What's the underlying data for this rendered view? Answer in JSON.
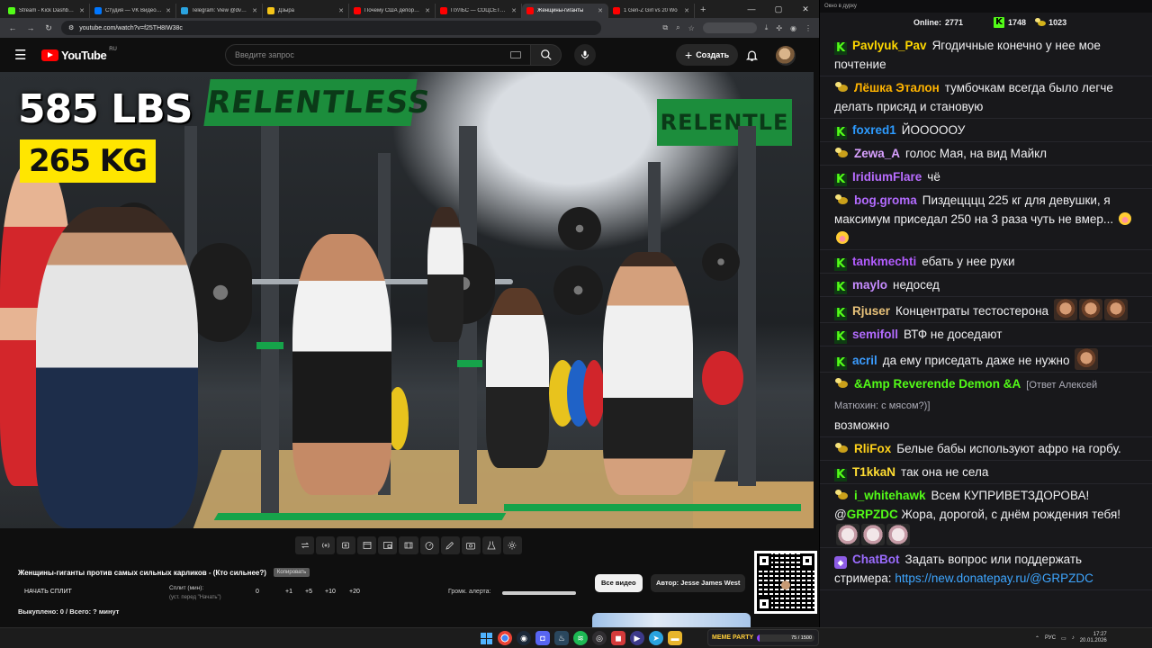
{
  "browser": {
    "tabs": [
      {
        "title": "Stream - Kick Dashboard",
        "color": "#53fc18",
        "active": false
      },
      {
        "title": "Студия — VK Видео Live",
        "color": "#0077ff",
        "active": false
      },
      {
        "title": "Telegram: View @dvach",
        "color": "#2aa3df",
        "active": false
      },
      {
        "title": "Дзыра",
        "color": "#f5c518",
        "active": false
      },
      {
        "title": "Почему США депортир",
        "color": "#ff0000",
        "active": false
      },
      {
        "title": "ПУЛЬС — СОЦСЕТЬ Д",
        "color": "#ff0000",
        "active": false
      },
      {
        "title": "Женщины-гиганты",
        "color": "#ff0000",
        "active": true
      },
      {
        "title": "1 Gen-Z Girl vs 20 Wo",
        "color": "#ff0000",
        "active": false
      }
    ],
    "new_tab": "+",
    "url": "youtube.com/watch?v=f25TH8IW38c"
  },
  "youtube": {
    "logo_text": "YouTube",
    "region": "RU",
    "search_placeholder": "Введите запрос",
    "create_label": "Создать",
    "video": {
      "overlay_weight_lbs": "585 LBS",
      "overlay_weight_kg": "265 KG",
      "banner_text": "RELENTLESS"
    },
    "title": "Женщины-гиганты против самых сильных карликов - (Кто сильнее?)",
    "copy_label": "Копировать",
    "split_button": "НАЧАТЬ СПЛИТ",
    "split_label": "Сплит (мин):",
    "split_sub": "(уст. перед \"Начать\")",
    "split_values": [
      "0",
      "+1",
      "+5",
      "+10",
      "+20"
    ],
    "alert_label": "Громк. алерта:",
    "bought_text": "Выкуплено: 0 / Всего: ? минут",
    "chip_all": "Все видео",
    "chip_author": "Автор: Jesse James West"
  },
  "chat": {
    "window_title": "Окно в дурку",
    "online_label": "Online:",
    "online_count": "2771",
    "kick_count": "1748",
    "coin_count": "1023",
    "messages": [
      {
        "badge": "kick",
        "user": "Pavlyuk_Pav",
        "color": "#ffd800",
        "text": "Ягодичные конечно у нее мое почтение"
      },
      {
        "badge": "coin",
        "user": "Лёшка Эталон",
        "color": "#ffb400",
        "text": "тумбочкам всегда было легче делать присяд и становую"
      },
      {
        "badge": "kick",
        "user": "foxred1",
        "color": "#2d9bff",
        "text": "ЙОООООУ"
      },
      {
        "badge": "coin",
        "user": "Zewa_A",
        "color": "#d8a0ff",
        "text": "голос Мая, на вид Майкл"
      },
      {
        "badge": "kick",
        "user": "IridiumFlare",
        "color": "#b86cff",
        "text": "чё"
      },
      {
        "badge": "coin",
        "user": "bog.groma",
        "color": "#b36bff",
        "text": "Пиздецццц 225 кг для девушки, я максимум приседал 250 на 3 раза чуть не вмер...",
        "emotes": "smile2"
      },
      {
        "badge": "kick",
        "user": "tankmechti",
        "color": "#b35cff",
        "text": "ебать у нее руки"
      },
      {
        "badge": "kick",
        "user": "maylo",
        "color": "#c68bff",
        "text": "недосед"
      },
      {
        "badge": "kick",
        "user": "Rjuser",
        "color": "#e8c27a",
        "text": "Концентраты тестостерона",
        "emotes": "face3"
      },
      {
        "badge": "kick",
        "user": "semifoll",
        "color": "#b26bff",
        "text": "ВТФ не доседают"
      },
      {
        "badge": "kick",
        "user": "acril",
        "color": "#3b9cff",
        "text": "да ему приседать даже не нужно",
        "emotes": "face1"
      },
      {
        "badge": "coin",
        "user": "&Amp Reverende Demon &A",
        "color": "#53fc18",
        "reply": "[Ответ Алексей Матюхин: с мясом?)]",
        "text": "возможно"
      },
      {
        "badge": "coin",
        "user": "RliFox",
        "color": "#ffd21a",
        "text": "Белые бабы используют афро на горбу."
      },
      {
        "badge": "kick",
        "user": "T1kkaN",
        "color": "#ffdd33",
        "text": "так она не села"
      },
      {
        "badge": "coin",
        "user": "i_whitehawk",
        "color": "#53fc18",
        "text_before": "Всем КУПРИВЕТЗДОРОВА! @",
        "mention": "GRPZDC",
        "text": "Жора, дорогой, с днём рождения тебя!",
        "emotes": "dog3"
      },
      {
        "badge": "bot",
        "user": "ChatBot",
        "color": "#9b6cff",
        "text": "Задать вопрос или поддержать стримера:",
        "link": "https://new.donatepay.ru/@GRPZDC"
      }
    ]
  },
  "taskbar": {
    "meme_party_label": "MEME PARTY",
    "meme_party_progress": "75 / 1500",
    "meme_party_fraction": 0.05,
    "lang": "РУС",
    "time": "17:27",
    "date": "20.01.2026"
  }
}
